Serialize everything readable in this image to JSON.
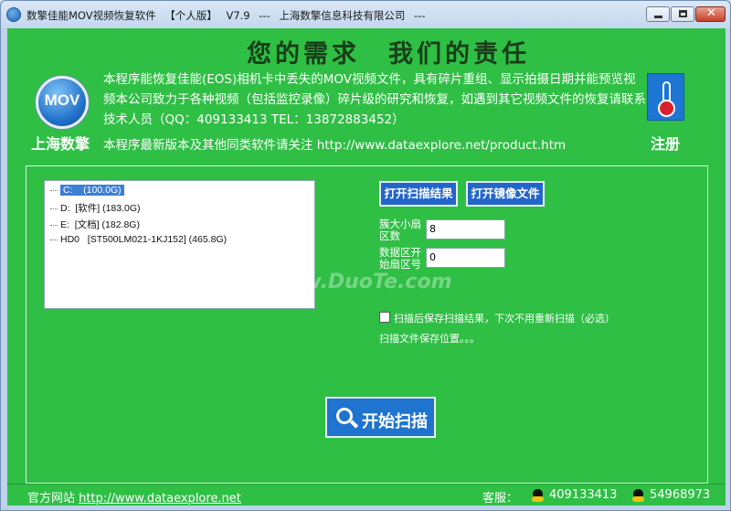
{
  "window": {
    "app_name": "数擎佳能MOV视频恢复软件",
    "edition": "【个人版】",
    "version": "V7.9",
    "separator": "---",
    "company": "上海数擎信息科技有限公司",
    "separator2": "---"
  },
  "header": {
    "slogan": "您的需求　我们的责任",
    "logo_text": "MOV",
    "company_short": "上海数擎",
    "description": "本程序能恢复佳能(EOS)相机卡中丢失的MOV视频文件，具有碎片重组、显示拍摄日期并能预览视频本公司致力于各种视频（包括监控录像）碎片级的研究和恢复，如遇到其它视频文件的恢复请联系技术人员（QQ：409133413 TEL：13872883452）",
    "url_line": "本程序最新版本及其他同类软件请关注 http://www.dataexplore.net/product.htm",
    "register_label": "注册",
    "register_icon": "thermometer-icon"
  },
  "drives": [
    {
      "prefix": "C:",
      "label": "(100.0G)",
      "selected": true
    },
    {
      "prefix": "D:",
      "label": "[软件]  (183.0G)",
      "selected": false
    },
    {
      "prefix": "E:",
      "label": "[文档]  (182.8G)",
      "selected": false
    },
    {
      "prefix": "HD0",
      "label": "[ST500LM021-1KJ152]  (465.8G)",
      "selected": false
    }
  ],
  "actions": {
    "open_scan_result": "打开扫描结果",
    "open_image_file": "打开镜像文件"
  },
  "fields": {
    "max_cluster_label": "簇大小扇区数",
    "max_cluster_value": "8",
    "start_sector_label": "数据区开始扇区号",
    "start_sector_value": "0"
  },
  "options": {
    "save_scan_label": "扫描后保存扫描结果，下次不用重新扫描（必选）",
    "save_scan_checked": false,
    "save_path_hint": "扫描文件保存位置。。。"
  },
  "scan_button": "开始扫描",
  "watermark": "www.DuoTe.com",
  "status": {
    "site_label": "官方网站",
    "site_url": "http://www.dataexplore.net",
    "service_label": "客服：",
    "qq1": "409133413",
    "qq2": "54968973"
  }
}
